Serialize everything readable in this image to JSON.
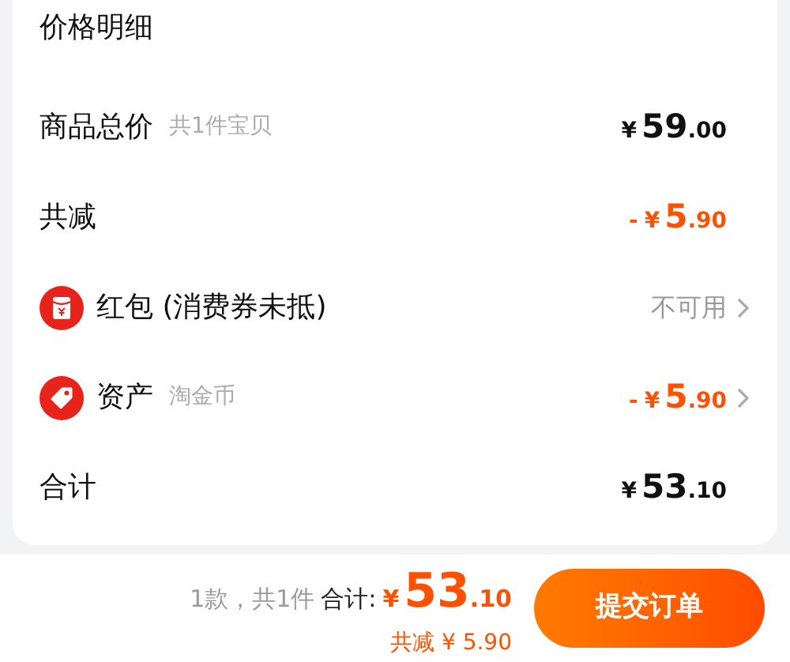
{
  "title": "价格明细",
  "rows": [
    {
      "kind": "plain",
      "label": "商品总价",
      "note": "共1件宝贝",
      "price": {
        "currency": "¥",
        "integer": "59",
        "decimal": ".00"
      },
      "color": "#111111",
      "chevron": false
    },
    {
      "kind": "plain",
      "label": "共减",
      "price": {
        "sign": "-",
        "currency": "¥",
        "integer": "5",
        "decimal": ".90"
      },
      "color": "#ff5000",
      "chevron": false
    },
    {
      "kind": "red-packet",
      "label": "红包 (消费券未抵)",
      "value": "不可用",
      "chevron": true
    },
    {
      "kind": "tag",
      "label": "资产",
      "note": "淘金币",
      "price": {
        "sign": "-",
        "currency": "¥",
        "integer": "5",
        "decimal": ".90"
      },
      "color": "#ff5000",
      "chevron": true
    },
    {
      "kind": "plain",
      "label": "合计",
      "price": {
        "currency": "¥",
        "integer": "53",
        "decimal": ".10"
      },
      "color": "#111111",
      "chevron": false
    }
  ],
  "footer": {
    "count": "1款，共1件",
    "total_label": "合计:",
    "total": {
      "currency": "¥",
      "integer": "53",
      "decimal": ".10"
    },
    "saving": "共减 ¥ 5.90",
    "button": "提交订单"
  }
}
